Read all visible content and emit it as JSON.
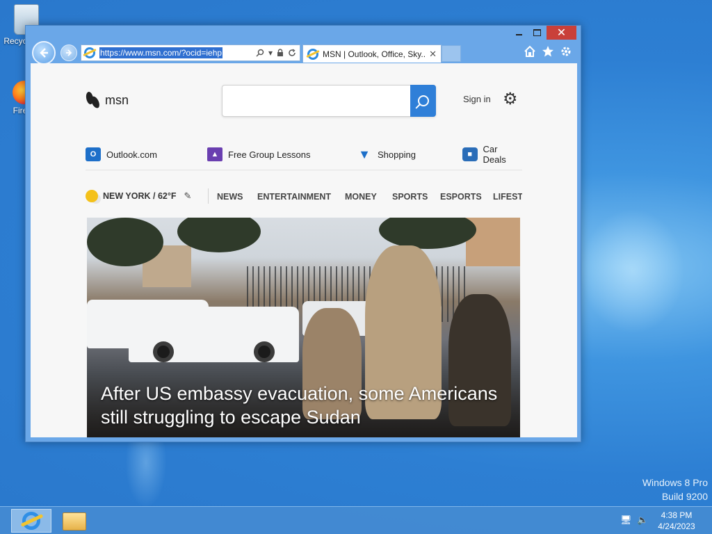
{
  "desktop": {
    "icons": [
      {
        "label": "Recycle Bin"
      },
      {
        "label": "Firefox"
      }
    ],
    "watermark": {
      "line1": "Windows 8 Pro",
      "line2": "Build 9200"
    }
  },
  "browser": {
    "address": {
      "url": "https://www.msn.com/?ocid=iehp"
    },
    "tab": {
      "title": "MSN | Outlook, Office, Sky..."
    },
    "icons": [
      "back-icon",
      "forward-icon",
      "search-icon",
      "lock-icon",
      "refresh-icon",
      "home-icon",
      "favorites-star-icon",
      "settings-gear-icon"
    ]
  },
  "msn": {
    "logo_text": "msn",
    "search": {
      "placeholder": ""
    },
    "sign_in": "Sign in",
    "quick_links": [
      {
        "label": "Outlook.com",
        "icon": "outlook-icon",
        "badge": "O"
      },
      {
        "label": "Free Group Lessons",
        "icon": "graduation-cap-icon",
        "badge": "🎓"
      },
      {
        "label": "Shopping",
        "icon": "shopping-cart-icon",
        "badge": "🛒"
      },
      {
        "label": "Car Deals",
        "icon": "car-icon",
        "badge": "🚗"
      }
    ],
    "weather": {
      "text": "NEW YORK / 62°F"
    },
    "nav": [
      "NEWS",
      "ENTERTAINMENT",
      "MONEY",
      "SPORTS",
      "ESPORTS",
      "LIFESTYLE"
    ],
    "hero": {
      "headline": "After US embassy evacuation, some Americans still struggling to escape Sudan"
    }
  },
  "taskbar": {
    "clock": {
      "time": "4:38 PM",
      "date": "4/24/2023"
    }
  },
  "colors": {
    "accent": "#2f7fd8",
    "close": "#c9403a",
    "desktop": "#2d7fd3"
  }
}
